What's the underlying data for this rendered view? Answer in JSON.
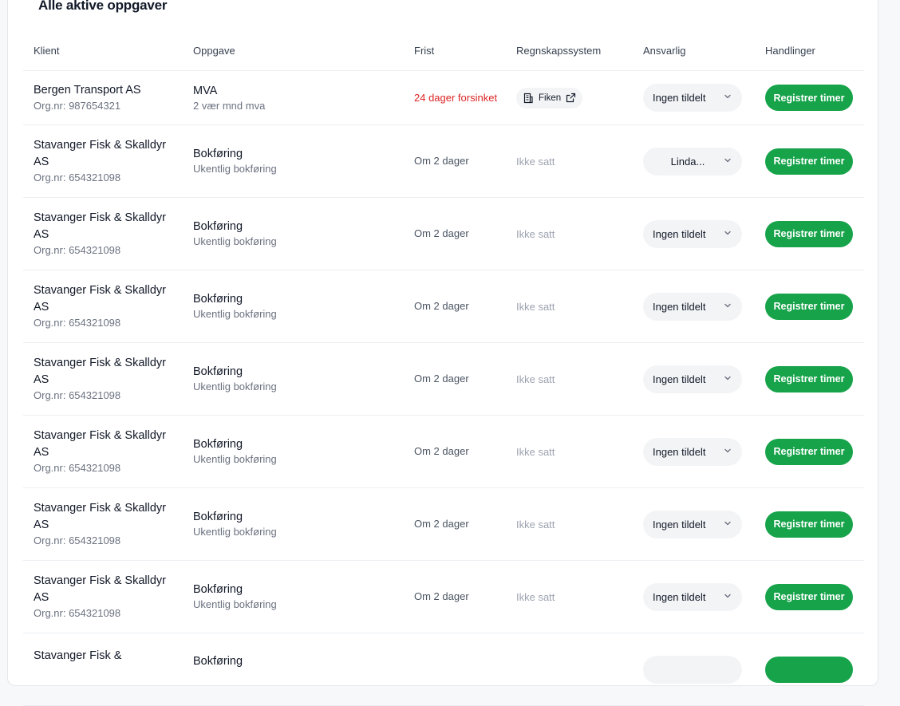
{
  "title": "Alle aktive oppgaver",
  "columns": {
    "client": "Klient",
    "task": "Oppgave",
    "due": "Frist",
    "system": "Regnskapssystem",
    "responsible": "Ansvarlig",
    "actions": "Handlinger"
  },
  "colors": {
    "accent": "#16a34a",
    "overdue": "#dc2626",
    "muted": "#6b7280"
  },
  "rows": [
    {
      "client_name": "Bergen Transport AS",
      "org": "Org.nr: 987654321",
      "task_name": "MVA",
      "task_sub": "2 vær mnd mva",
      "due": "24 dager forsinket",
      "overdue": true,
      "system": "Fiken",
      "system_icon": "building-icon",
      "system_link_icon": "external-link-icon",
      "responsible": "Ingen tildelt",
      "action": "Registrer timer"
    },
    {
      "client_name": "Stavanger Fisk & Skalldyr AS",
      "org": "Org.nr: 654321098",
      "task_name": "Bokføring",
      "task_sub": "Ukentlig bokføring",
      "due": "Om 2 dager",
      "overdue": false,
      "system": "Ikke satt",
      "responsible": "Linda...",
      "action": "Registrer timer"
    },
    {
      "client_name": "Stavanger Fisk & Skalldyr AS",
      "org": "Org.nr: 654321098",
      "task_name": "Bokføring",
      "task_sub": "Ukentlig bokføring",
      "due": "Om 2 dager",
      "overdue": false,
      "system": "Ikke satt",
      "responsible": "Ingen tildelt",
      "action": "Registrer timer"
    },
    {
      "client_name": "Stavanger Fisk & Skalldyr AS",
      "org": "Org.nr: 654321098",
      "task_name": "Bokføring",
      "task_sub": "Ukentlig bokføring",
      "due": "Om 2 dager",
      "overdue": false,
      "system": "Ikke satt",
      "responsible": "Ingen tildelt",
      "action": "Registrer timer"
    },
    {
      "client_name": "Stavanger Fisk & Skalldyr AS",
      "org": "Org.nr: 654321098",
      "task_name": "Bokføring",
      "task_sub": "Ukentlig bokføring",
      "due": "Om 2 dager",
      "overdue": false,
      "system": "Ikke satt",
      "responsible": "Ingen tildelt",
      "action": "Registrer timer"
    },
    {
      "client_name": "Stavanger Fisk & Skalldyr AS",
      "org": "Org.nr: 654321098",
      "task_name": "Bokføring",
      "task_sub": "Ukentlig bokføring",
      "due": "Om 2 dager",
      "overdue": false,
      "system": "Ikke satt",
      "responsible": "Ingen tildelt",
      "action": "Registrer timer"
    },
    {
      "client_name": "Stavanger Fisk & Skalldyr AS",
      "org": "Org.nr: 654321098",
      "task_name": "Bokføring",
      "task_sub": "Ukentlig bokføring",
      "due": "Om 2 dager",
      "overdue": false,
      "system": "Ikke satt",
      "responsible": "Ingen tildelt",
      "action": "Registrer timer"
    },
    {
      "client_name": "Stavanger Fisk & Skalldyr AS",
      "org": "Org.nr: 654321098",
      "task_name": "Bokføring",
      "task_sub": "Ukentlig bokføring",
      "due": "Om 2 dager",
      "overdue": false,
      "system": "Ikke satt",
      "responsible": "Ingen tildelt",
      "action": "Registrer timer"
    },
    {
      "client_name": "Stavanger Fisk &",
      "org": "",
      "task_name": "Bokføring",
      "task_sub": "",
      "due": "",
      "overdue": false,
      "system": "",
      "responsible": "",
      "action": ""
    }
  ]
}
